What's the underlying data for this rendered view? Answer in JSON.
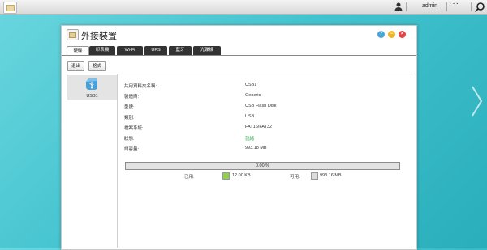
{
  "taskbar": {
    "user": "admin",
    "more": "···"
  },
  "window": {
    "title": "外接裝置",
    "help_label": "?",
    "minimize_label": "−",
    "close_label": "×"
  },
  "tabs": [
    {
      "label": "硬碟",
      "active": true
    },
    {
      "label": "印表機",
      "active": false
    },
    {
      "label": "Wi-Fi",
      "active": false
    },
    {
      "label": "UPS",
      "active": false
    },
    {
      "label": "藍牙",
      "active": false
    },
    {
      "label": "光碟機",
      "active": false
    }
  ],
  "toolbar": {
    "eject_label": "退出",
    "format_label": "格式"
  },
  "devices": [
    {
      "name": "USB1",
      "icon": "usb-drive-icon",
      "selected": true
    }
  ],
  "details": [
    {
      "label": "共用資料夾名稱:",
      "value": "USB1",
      "status": false
    },
    {
      "label": "製造商:",
      "value": "Generic",
      "status": false
    },
    {
      "label": "型號:",
      "value": "USB Flash Disk",
      "status": false
    },
    {
      "label": "類別:",
      "value": "USB",
      "status": false
    },
    {
      "label": "檔案系統:",
      "value": "FAT16/FAT32",
      "status": false
    },
    {
      "label": "狀態:",
      "value": "就緒",
      "status": true
    },
    {
      "label": "總容量:",
      "value": "993.18 MB",
      "status": false
    }
  ],
  "usage": {
    "percent_text": "0.00 %",
    "used_fraction": 0.0001,
    "used_label": "已用:",
    "used_value": "12.00 KB",
    "free_label": "可用:",
    "free_value": "993.16 MB"
  },
  "colors": {
    "used_swatch": "#8fd14f",
    "free_swatch": "#dcdcdc",
    "status_ok": "#2ea84a"
  }
}
